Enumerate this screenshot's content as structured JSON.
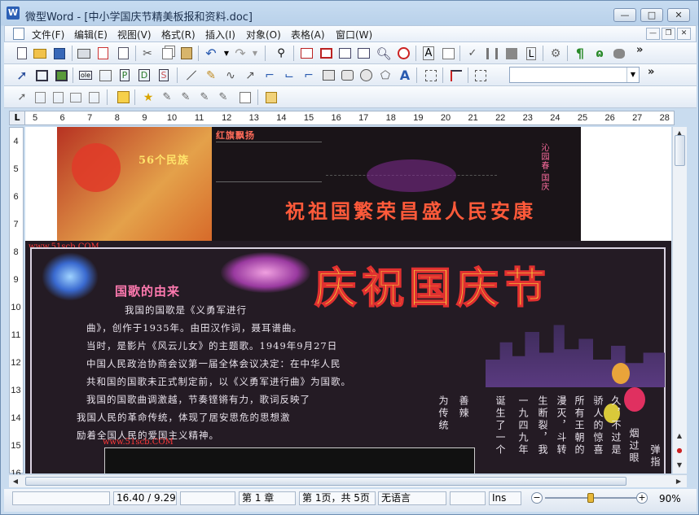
{
  "window": {
    "app_name": "微型Word",
    "title": "微型Word - [中小学国庆节精美板报和资料.doc]",
    "app_icon": "W",
    "controls": {
      "minimize": "—",
      "maximize": "□",
      "close": "✕"
    }
  },
  "menubar": {
    "items": [
      "文件(F)",
      "编辑(E)",
      "视图(V)",
      "格式(R)",
      "插入(I)",
      "对象(O)",
      "表格(A)",
      "窗口(W)"
    ]
  },
  "toolbar": {
    "font_box_value": "",
    "more": "»"
  },
  "ruler": {
    "corner": "L",
    "top_numbers": [
      "5",
      "6",
      "7",
      "8",
      "9",
      "10",
      "11",
      "12",
      "13",
      "14",
      "15",
      "16",
      "17",
      "18",
      "19",
      "20",
      "21",
      "22",
      "23",
      "24",
      "25",
      "26",
      "27",
      "28"
    ],
    "left_numbers": [
      "4",
      "5",
      "6",
      "7",
      "8",
      "9",
      "10",
      "11",
      "12",
      "13",
      "14",
      "15",
      "16"
    ]
  },
  "document": {
    "image1": {
      "texts": [
        "56个民族",
        "红旗飘扬",
        "沁园春·国庆",
        "祝祖国繁荣昌盛人民安康",
        "www.51scb.com"
      ]
    },
    "image2": {
      "watermark_top": "www.51scb.COM",
      "heading": "庆祝国庆节",
      "subheading": "国歌的由来",
      "paragraph_lines": [
        "我国的国歌是《义勇军进行",
        "曲》，创作于1935年。由田汉作词，聂耳谱曲。",
        "当时，是影片《风云儿女》的主题歌。1949年9月27日",
        "中国人民政治协商会议第一届全体会议决定：在中华人民",
        "共和国的国歌未正式制定前，以《义勇军进行曲》为国歌。",
        "我国的国歌曲调激越，节奏铿锵有力，歌词反映了",
        "我国人民的革命传统，体现了居安思危的思想激",
        "励着全国人民的爱国主义精神。"
      ],
      "watermark_bottom": "www.51scb.COM",
      "vertical_columns": [
        "为传统",
        "善辣",
        "诞生了一个",
        "一九四九年",
        "生断裂，我",
        "漫灭，斗转",
        "所有王朝的",
        "骄人的惊喜",
        "久，不过是",
        "烟过眼",
        "弹指"
      ]
    }
  },
  "statusbar": {
    "cells": [
      "",
      "16.40 / 9.29",
      "",
      "第 1 章",
      "第 1页，共 5页",
      "无语言",
      "",
      "Ins"
    ],
    "zoom": "90%",
    "zoom_level": 0.5
  },
  "colors": {
    "title_bg": "#c7dcf1",
    "heading_yellow": "#f6d23a",
    "heading_outline": "#e03030",
    "chalk_text": "#e9e3ec",
    "blackboard": "#241b24"
  }
}
